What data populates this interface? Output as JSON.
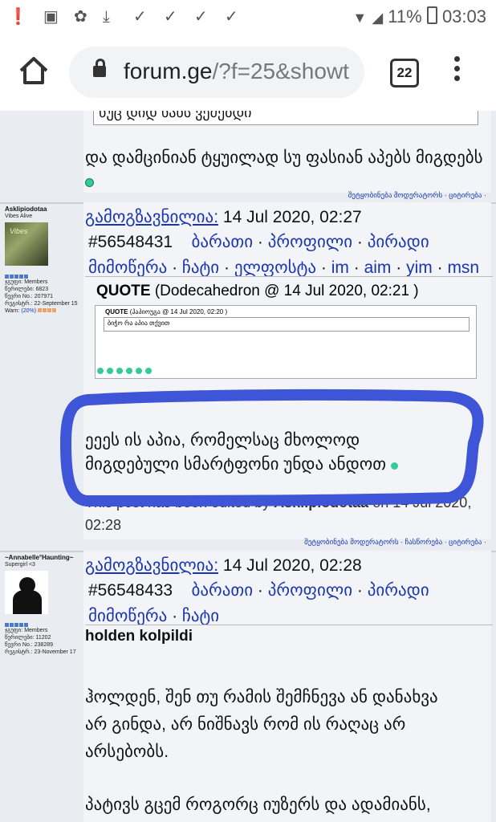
{
  "status": {
    "battery": "11%",
    "time": "03:03"
  },
  "browser": {
    "url_host": "forum.ge",
    "url_path": "/?f=25&showt",
    "tab_count": "22"
  },
  "post0": {
    "quote_tail": "ნუც დიდ ხანს ვეძებდი",
    "text": "და დამცინიან ტყუილად სუ ფასიან აპებს მიგდებს",
    "footer": "შეტყობინება მოდერატორს · ციტირება ·"
  },
  "post1": {
    "username": "Asklipiodotaa",
    "title": "Vibes Alive",
    "group": "ჯგუფი: Members",
    "posts": "წერილები: 6823",
    "member_no": "წევრი No.: 207971",
    "reg": "რეგისტრ.: 22-September 15",
    "warn_label": "Warn:",
    "warn_value": "(20%)",
    "sent_label": "გამოგზავნილია:",
    "sent_date": "14 Jul 2020, 02:27",
    "post_id": "#56548431",
    "links": [
      "ბარათი",
      "პროფილი",
      "პირადი მიმოწერა",
      "ჩატი",
      "ელფოსტა",
      "im",
      "aim",
      "yim",
      "msn"
    ],
    "quote_label": "QUOTE",
    "quote_src": "(Dodecahedron @ 14 Jul 2020, 02:21 )",
    "inner_quote_label": "QUOTE",
    "inner_quote_src": "(ჰაპიოუგა @ 14 Jul 2020, 02:20 )",
    "inner_quote_text": "ბიჭო რა აპია თქვით",
    "body1": "ეეეს ის აპია, რომელსაც მხოლოდ",
    "body2": "მიგდებული სმარტფონი უნდა ანდოთ",
    "edited_a": "This post has been edited by",
    "edited_user": "Asklipiodotaa",
    "edited_b": "on 14 Jul 2020,",
    "edited_time": "02:28",
    "footer": "შეტყობინება მოდერატორს · ჩასწორება · ციტირება ·"
  },
  "post2": {
    "username": "~Annabelle°Haunting~",
    "title": "Supergirl <3",
    "group": "ჯგუფი: Members",
    "posts": "წერილები: 11202",
    "member_no": "წევრი No.: 238289",
    "reg": "რეგისტრ.: 23-November 17",
    "sent_label": "გამოგზავნილია:",
    "sent_date": "14 Jul 2020, 02:28",
    "post_id": "#56548433",
    "links": [
      "ბარათი",
      "პროფილი",
      "პირადი მიმოწერა",
      "ჩატი"
    ],
    "heading": "holden kolpildi",
    "para1": "ჰოლდენ, შენ თუ რამის შემჩნევა ან დანახვა არ გინდა, არ ნიშნავს რომ ის რაღაც არ არსებობს.",
    "para2": "პატივს გცემ როგორც იუზერს და ადამიანს,"
  },
  "colors": {
    "link": "#1a35b3",
    "marker": "#3d55d6",
    "bg": "#e9edf1"
  }
}
